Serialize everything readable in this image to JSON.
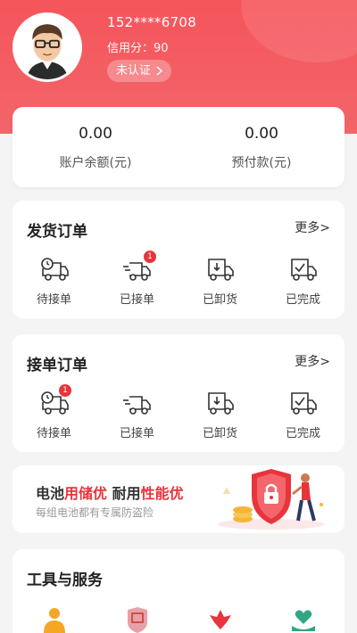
{
  "profile": {
    "phone": "152****6708",
    "credit_label": "信用分",
    "credit_value": "90",
    "verify_label": "未认证"
  },
  "balance": {
    "items": [
      {
        "value": "0.00",
        "label": "账户余额(元)"
      },
      {
        "value": "0.00",
        "label": "预付款(元)"
      }
    ]
  },
  "ship_orders": {
    "title": "发货订单",
    "more": "更多>",
    "items": [
      {
        "label": "待接单",
        "icon": "truck-clock-icon",
        "badge": ""
      },
      {
        "label": "已接单",
        "icon": "truck-moving-icon",
        "badge": "1"
      },
      {
        "label": "已卸货",
        "icon": "unload-icon",
        "badge": ""
      },
      {
        "label": "已完成",
        "icon": "truck-check-icon",
        "badge": ""
      }
    ]
  },
  "take_orders": {
    "title": "接单订单",
    "more": "更多>",
    "items": [
      {
        "label": "待接单",
        "icon": "truck-clock-icon",
        "badge": "1"
      },
      {
        "label": "已接单",
        "icon": "truck-moving-icon",
        "badge": ""
      },
      {
        "label": "已卸货",
        "icon": "unload-icon",
        "badge": ""
      },
      {
        "label": "已完成",
        "icon": "truck-check-icon",
        "badge": ""
      }
    ]
  },
  "banner": {
    "part1": "电池",
    "part2": "用储优",
    "part3": " 耐用",
    "part4": "性能优",
    "subtitle": "每组电池都有专属防盗险"
  },
  "tools": {
    "title": "工具与服务"
  },
  "colors": {
    "accent": "#f5555b",
    "badge": "#e8343b"
  }
}
